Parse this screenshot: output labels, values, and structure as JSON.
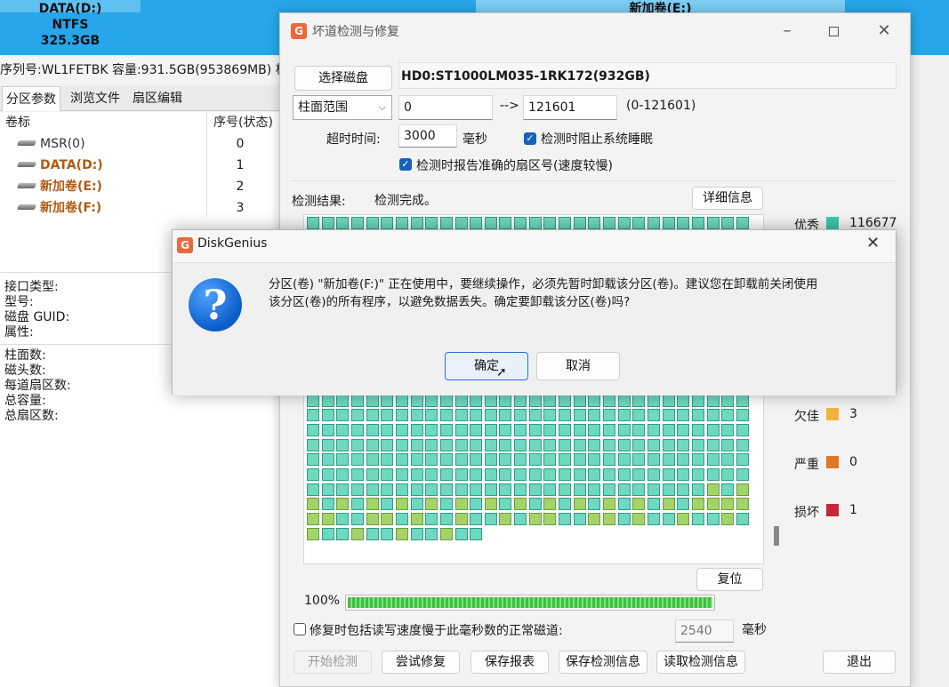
{
  "partitions_top": [
    {
      "name": "DATA(D:)",
      "fs": "NTFS",
      "size": "325.3GB"
    },
    {
      "name": "新加卷(E:)"
    }
  ],
  "disk_info_line": "序列号:WL1FETBK  容量:931.5GB(953869MB)  柱",
  "left_tabs": [
    "分区参数",
    "浏览文件",
    "扇区编辑"
  ],
  "table": {
    "headers": [
      "卷标",
      "序号(状态)"
    ],
    "rows": [
      {
        "name": "MSR(0)",
        "index": "0"
      },
      {
        "name": "DATA(D:)",
        "index": "1"
      },
      {
        "name": "新加卷(E:)",
        "index": "2"
      },
      {
        "name": "新加卷(F:)",
        "index": "3"
      }
    ]
  },
  "props_group1": [
    "接口类型:",
    "型号:",
    "磁盘 GUID:",
    "属性:"
  ],
  "props_group2": [
    "柱面数:",
    "磁头数:",
    "每道扇区数:",
    "总容量:",
    "总扇区数:"
  ],
  "dialog": {
    "title": "坏道检测与修复",
    "select_disk_label": "选择磁盘",
    "disk_name": "HD0:ST1000LM035-1RK172(932GB)",
    "range_mode": "柱面范围",
    "range_start": "0",
    "arrow": "-->",
    "range_end": "121601",
    "range_hint": "(0-121601)",
    "timeout_label": "超时时间:",
    "timeout_value": "3000",
    "timeout_unit": "毫秒",
    "prevent_sleep_label": "检测时阻止系统睡眠",
    "report_sector_label": "检测时报告准确的扇区号(速度较慢)",
    "result_label": "检测结果:",
    "result_text": "检测完成。",
    "details_button": "详细信息",
    "legend": [
      {
        "label": "优秀",
        "color": "#3cc9a4",
        "count": "116677"
      },
      {
        "label": "欠佳",
        "color": "#f0b43c",
        "count": "3"
      },
      {
        "label": "严重",
        "color": "#e0782a",
        "count": "0"
      },
      {
        "label": "损坏",
        "color": "#c8263c",
        "count": "1"
      }
    ],
    "reset_button": "复位",
    "progress_text": "100%",
    "progress_value": 1.0,
    "slow_track_label": "修复时包括读写速度慢于此毫秒数的正常磁道:",
    "slow_track_value": "2540",
    "slow_track_unit": "毫秒",
    "buttons": {
      "start": "开始检测",
      "try_repair": "尝试修复",
      "save_report": "保存报表",
      "save_info": "保存检测信息",
      "read_info": "读取检测信息",
      "exit": "退出"
    }
  },
  "modal": {
    "title": "DiskGenius",
    "message_line1": "分区(卷) \"新加卷(F:)\" 正在使用中，要继续操作，必须先暂时卸载该分区(卷)。建议您在卸载前关闭使用",
    "message_line2": "该分区(卷)的所有程序，以避免数据丢失。确定要卸载该分区(卷)吗?",
    "ok": "确定",
    "cancel": "取消"
  }
}
